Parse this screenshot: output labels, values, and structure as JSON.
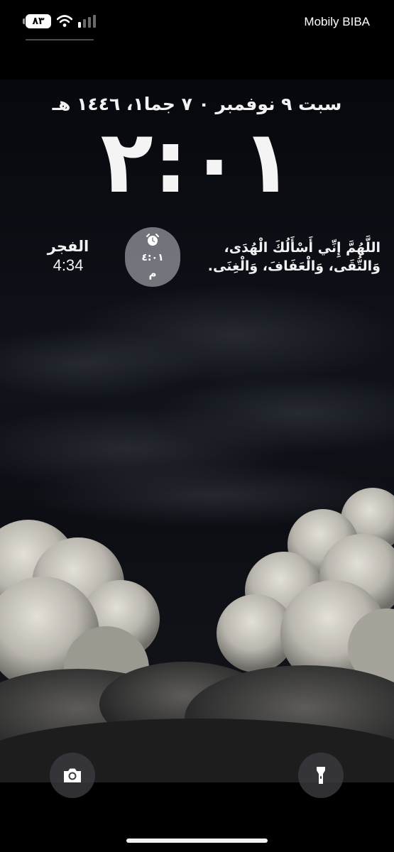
{
  "status_bar": {
    "battery_level": "٨٣",
    "carrier": "Mobily BIBA",
    "icons": [
      "wifi-icon",
      "cellular-signal-icon",
      "battery-icon"
    ]
  },
  "lock_screen": {
    "date_line": "سبت ٩ نوفمبر ٠ ٧ جما١، ١٤٤٦ هـ",
    "clock_time": "٢:٠١"
  },
  "widgets": {
    "prayer": {
      "name": "الفجر",
      "time": "4:34"
    },
    "alarm": {
      "icon": "alarm-clock-icon",
      "time": "٤:٠١",
      "period": "م"
    },
    "dua": {
      "line1": "اللَّهُمَّ إِنِّي أَسْأَلُكَ الْهُدَى،",
      "line2": "وَالتُّقَى، وَالْعَفَافَ، وَالْغِنَى."
    }
  },
  "quick_actions": {
    "left_icon": "camera-icon",
    "right_icon": "flashlight-icon"
  },
  "colors": {
    "sky": "#0b0d13",
    "clouds": "#c9c6bd",
    "widget_pill": "#9a9aa3",
    "text": "#ffffff"
  }
}
